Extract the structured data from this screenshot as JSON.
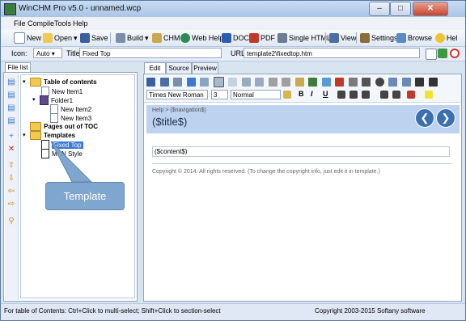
{
  "window": {
    "title": "WinCHM Pro v5.0 - unnamed.wcp",
    "minimize": "–",
    "maximize": "□",
    "close": "✕"
  },
  "menu": [
    "File",
    "Compile",
    "Tools",
    "Help"
  ],
  "toolbar": {
    "new": "New",
    "open": "Open",
    "save": "Save",
    "build": "Build",
    "chm": "CHM",
    "webhelp": "Web Help",
    "doc": "DOC",
    "pdf": "PDF",
    "single_html": "Single HTML",
    "view": "View",
    "settings": "Settings",
    "browse": "Browse",
    "help": "Hel"
  },
  "props": {
    "icon_label": "Icon:",
    "icon_value": "Auto",
    "title_label": "Title",
    "title_value": "Fixed Top",
    "url_label": "URL",
    "url_value": "template2\\fixedtop.htm"
  },
  "left": {
    "tab": "File list",
    "tree": {
      "toc": "Table of contents",
      "item1": "New Item1",
      "folder1": "Folder1",
      "item2": "New Item2",
      "item3": "New Item3",
      "pages_out": "Pages out of TOC",
      "templates": "Templates",
      "fixed_top": "Fixed Top",
      "msn_style": "MSN Style"
    },
    "callout": "Template"
  },
  "editor": {
    "tabs": [
      "Edit",
      "Source",
      "Preview"
    ],
    "font": "Times New Roman",
    "size": "3",
    "style": "Normal",
    "format": {
      "bold": "B",
      "italic": "I",
      "underline": "U"
    }
  },
  "doc": {
    "breadcrumb": "Help > ($navigation$)",
    "title": "($title$)",
    "content": "($content$)",
    "copyright": "Copyright © 2014. All rights reserved. (To change the copyright info, just edit it in template.)"
  },
  "status": {
    "left": "For table of Contents: Ctrl+Click to multi-select; Shift+Click to section-select",
    "right": "Copyright 2003-2015 Softany software"
  },
  "colors": {
    "accent": "#3a78d2",
    "header_bg": "#bcd2ee",
    "callout": "#7fa6cf"
  }
}
